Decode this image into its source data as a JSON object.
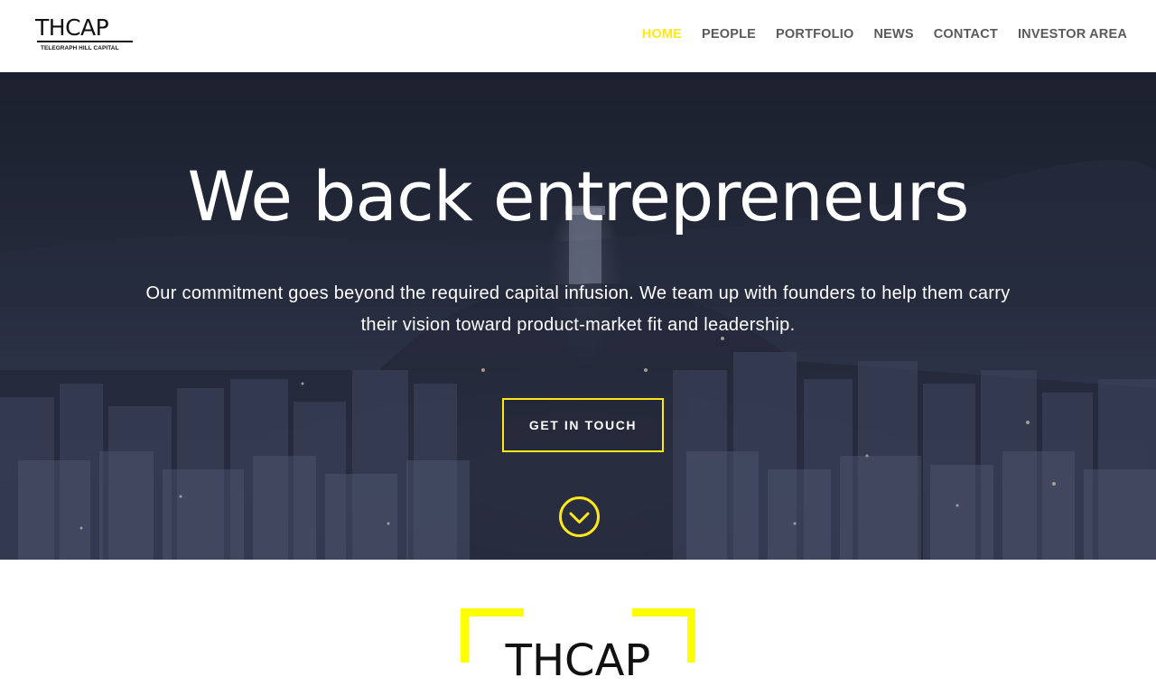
{
  "brand": {
    "name": "THCAP",
    "tagline": "TELEGRAPH HILL CAPITAL"
  },
  "nav": {
    "items": [
      {
        "label": "HOME",
        "active": true
      },
      {
        "label": "PEOPLE",
        "active": false
      },
      {
        "label": "PORTFOLIO",
        "active": false
      },
      {
        "label": "NEWS",
        "active": false
      },
      {
        "label": "CONTACT",
        "active": false
      },
      {
        "label": "INVESTOR AREA",
        "active": false
      }
    ]
  },
  "hero": {
    "title": "We back entrepreneurs",
    "text": "Our commitment goes beyond the required capital infusion. We team up with founders to help them carry their vision toward product-market fit and leadership.",
    "cta_label": "GET IN TOUCH",
    "scroll_icon": "chevron-down-circle-icon"
  },
  "section_logo": {
    "text": "THCAP"
  },
  "colors": {
    "accent": "#ffe81a",
    "frame": "#ffff00",
    "nav_text": "#5a5a5a",
    "hero_text": "#ffffff"
  }
}
